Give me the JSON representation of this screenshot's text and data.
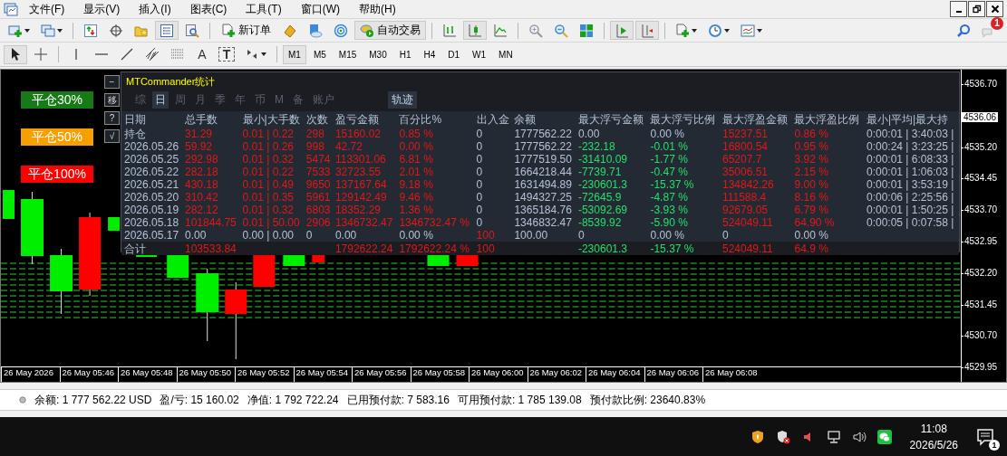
{
  "menu": [
    "文件(F)",
    "显示(V)",
    "插入(I)",
    "图表(C)",
    "工具(T)",
    "窗口(W)",
    "帮助(H)"
  ],
  "toolbar_1": [
    {
      "kind": "icon",
      "pressed": false
    },
    {
      "kind": "icon",
      "pressed": false
    },
    {
      "kind": "separator"
    },
    {
      "kind": "icon",
      "pressed": false
    },
    {
      "kind": "icon",
      "pressed": false
    },
    {
      "kind": "icon",
      "pressed": false
    },
    {
      "kind": "icon",
      "pressed": true
    },
    {
      "kind": "icon",
      "pressed": false
    },
    {
      "kind": "separator"
    },
    {
      "kind": "text",
      "label": "新订单",
      "pressed": false
    },
    {
      "kind": "icon",
      "pressed": false
    },
    {
      "kind": "icon",
      "pressed": false
    },
    {
      "kind": "icon",
      "pressed": false
    },
    {
      "kind": "text",
      "label": "自动交易",
      "pressed": true
    },
    {
      "kind": "separator"
    },
    {
      "kind": "icon",
      "pressed": false
    },
    {
      "kind": "icon",
      "pressed": true
    },
    {
      "kind": "icon",
      "pressed": false
    },
    {
      "kind": "separator"
    },
    {
      "kind": "icon",
      "pressed": false
    },
    {
      "kind": "icon",
      "pressed": false
    },
    {
      "kind": "icon",
      "pressed": false
    },
    {
      "kind": "separator"
    },
    {
      "kind": "icon",
      "pressed": true
    },
    {
      "kind": "icon",
      "pressed": true
    },
    {
      "kind": "separator"
    },
    {
      "kind": "icon",
      "pressed": false
    },
    {
      "kind": "icon",
      "pressed": false
    },
    {
      "kind": "icon",
      "pressed": false
    }
  ],
  "chat_badge": "1",
  "toolbar_2": [
    {
      "kind": "icon",
      "pressed": true
    },
    {
      "kind": "icon",
      "pressed": false
    },
    {
      "kind": "separator"
    },
    {
      "kind": "icon",
      "pressed": false
    },
    {
      "kind": "icon",
      "pressed": false
    },
    {
      "kind": "icon",
      "pressed": false
    },
    {
      "kind": "icon",
      "pressed": false
    },
    {
      "kind": "icon",
      "pressed": false
    },
    {
      "kind": "text",
      "label": "A",
      "pressed": false
    },
    {
      "kind": "text",
      "label": "T",
      "pressed": false
    },
    {
      "kind": "icon",
      "pressed": false
    }
  ],
  "timeframes": [
    {
      "label": "M1",
      "selected": true
    },
    {
      "label": "M5",
      "selected": false
    },
    {
      "label": "M15",
      "selected": false
    },
    {
      "label": "M30",
      "selected": false
    },
    {
      "label": "H1",
      "selected": false
    },
    {
      "label": "H4",
      "selected": false
    },
    {
      "label": "D1",
      "selected": false
    },
    {
      "label": "W1",
      "selected": false
    },
    {
      "label": "MN",
      "selected": false
    }
  ],
  "chart": {
    "close_buttons": [
      {
        "label": "平仓30%",
        "color": "#167a16"
      },
      {
        "label": "平仓50%",
        "color": "#f5a000"
      },
      {
        "label": "平仓100%",
        "color": "#ff0000"
      }
    ],
    "side_buttons": [
      "−",
      "移",
      "?",
      "√"
    ],
    "price_axis": {
      "labels": [
        "4536.70",
        "4535.20",
        "4534.45",
        "4533.70",
        "4532.95",
        "4532.20",
        "4531.45",
        "4530.70",
        "4529.95"
      ],
      "current": "4536.06"
    },
    "time_axis": [
      "26 May 2026",
      "26 May 05:46",
      "26 May 05:48",
      "26 May 05:50",
      "26 May 05:52",
      "26 May 05:54",
      "26 May 05:56",
      "26 May 05:58",
      "26 May 06:00",
      "26 May 06:02",
      "26 May 06:04",
      "26 May 06:06",
      "26 May 06:08"
    ]
  },
  "stats_panel": {
    "title": "MTCommander统计",
    "tabs": [
      {
        "label": "综",
        "selected": false
      },
      {
        "label": "日",
        "selected": true
      },
      {
        "label": "周",
        "selected": false
      },
      {
        "label": "月",
        "selected": false
      },
      {
        "label": "季",
        "selected": false
      },
      {
        "label": "年",
        "selected": false
      },
      {
        "label": "币",
        "selected": false
      },
      {
        "label": "M",
        "selected": false
      },
      {
        "label": "备",
        "selected": false
      },
      {
        "label": "账户",
        "selected": false
      }
    ],
    "trail_button": "轨迹",
    "columns": [
      "日期",
      "总手数",
      "最小|大手数",
      "次数",
      "盈亏金额",
      "百分比%",
      "出入金",
      "余额",
      "最大浮亏金额",
      "最大浮亏比例",
      "最大浮盈金额",
      "最大浮盈比例",
      "最小|平均|最大持"
    ],
    "rows": [
      {
        "cells": [
          {
            "text": "持仓"
          },
          {
            "text": "31.29",
            "color": "#e01818"
          },
          {
            "text": "0.01 | 0.22",
            "color": "#e01818"
          },
          {
            "text": "298",
            "color": "#e01818"
          },
          {
            "text": "15160.02",
            "color": "#e01818"
          },
          {
            "text": "0.85 %",
            "color": "#e01818"
          },
          {
            "text": "0",
            "color": "#b4c2d6"
          },
          {
            "text": "1777562.22",
            "color": "#b4c2d6"
          },
          {
            "text": "0.00",
            "color": "#b4c2d6"
          },
          {
            "text": "0.00 %",
            "color": "#b4c2d6"
          },
          {
            "text": "15237.51",
            "color": "#e01818"
          },
          {
            "text": "0.86 %",
            "color": "#e01818"
          },
          {
            "text": "0:00:01 | 3:40:03 |",
            "color": "#b4c2d6"
          }
        ]
      },
      {
        "cells": [
          {
            "text": "2026.05.26",
            "color": "#b4c2d6"
          },
          {
            "text": "59.92",
            "color": "#e01818"
          },
          {
            "text": "0.01 | 0.26",
            "color": "#e01818"
          },
          {
            "text": "998",
            "color": "#e01818"
          },
          {
            "text": "42.72",
            "color": "#e01818"
          },
          {
            "text": "0.00 %",
            "color": "#e01818"
          },
          {
            "text": "0",
            "color": "#b4c2d6"
          },
          {
            "text": "1777562.22",
            "color": "#b4c2d6"
          },
          {
            "text": "-232.18",
            "color": "#22e06a"
          },
          {
            "text": "-0.01 %",
            "color": "#22e06a"
          },
          {
            "text": "16800.54",
            "color": "#e01818"
          },
          {
            "text": "0.95 %",
            "color": "#e01818"
          },
          {
            "text": "0:00:24 | 3:23:25 |",
            "color": "#b4c2d6"
          }
        ]
      },
      {
        "cells": [
          {
            "text": "2026.05.25",
            "color": "#b4c2d6"
          },
          {
            "text": "292.98",
            "color": "#e01818"
          },
          {
            "text": "0.01 | 0.32",
            "color": "#e01818"
          },
          {
            "text": "5474",
            "color": "#e01818"
          },
          {
            "text": "113301.06",
            "color": "#e01818"
          },
          {
            "text": "6.81 %",
            "color": "#e01818"
          },
          {
            "text": "0",
            "color": "#b4c2d6"
          },
          {
            "text": "1777519.50",
            "color": "#b4c2d6"
          },
          {
            "text": "-31410.09",
            "color": "#22e06a"
          },
          {
            "text": "-1.77 %",
            "color": "#22e06a"
          },
          {
            "text": "65207.7",
            "color": "#e01818"
          },
          {
            "text": "3.92 %",
            "color": "#e01818"
          },
          {
            "text": "0:00:01 | 6:08:33 |",
            "color": "#b4c2d6"
          }
        ]
      },
      {
        "cells": [
          {
            "text": "2026.05.22",
            "color": "#b4c2d6"
          },
          {
            "text": "282.18",
            "color": "#e01818"
          },
          {
            "text": "0.01 | 0.22",
            "color": "#e01818"
          },
          {
            "text": "7533",
            "color": "#e01818"
          },
          {
            "text": "32723.55",
            "color": "#e01818"
          },
          {
            "text": "2.01 %",
            "color": "#e01818"
          },
          {
            "text": "0",
            "color": "#b4c2d6"
          },
          {
            "text": "1664218.44",
            "color": "#b4c2d6"
          },
          {
            "text": "-7739.71",
            "color": "#22e06a"
          },
          {
            "text": "-0.47 %",
            "color": "#22e06a"
          },
          {
            "text": "35006.51",
            "color": "#e01818"
          },
          {
            "text": "2.15 %",
            "color": "#e01818"
          },
          {
            "text": "0:00:01 | 1:06:03 |",
            "color": "#b4c2d6"
          }
        ]
      },
      {
        "cells": [
          {
            "text": "2026.05.21",
            "color": "#b4c2d6"
          },
          {
            "text": "430.18",
            "color": "#e01818"
          },
          {
            "text": "0.01 | 0.49",
            "color": "#e01818"
          },
          {
            "text": "9650",
            "color": "#e01818"
          },
          {
            "text": "137167.64",
            "color": "#e01818"
          },
          {
            "text": "9.18 %",
            "color": "#e01818"
          },
          {
            "text": "0",
            "color": "#b4c2d6"
          },
          {
            "text": "1631494.89",
            "color": "#b4c2d6"
          },
          {
            "text": "-230601.3",
            "color": "#22e06a"
          },
          {
            "text": "-15.37 %",
            "color": "#22e06a"
          },
          {
            "text": "134842.26",
            "color": "#e01818"
          },
          {
            "text": "9.00 %",
            "color": "#e01818"
          },
          {
            "text": "0:00:01 | 3:53:19 |",
            "color": "#b4c2d6"
          }
        ]
      },
      {
        "cells": [
          {
            "text": "2026.05.20",
            "color": "#b4c2d6"
          },
          {
            "text": "310.42",
            "color": "#e01818"
          },
          {
            "text": "0.01 | 0.35",
            "color": "#e01818"
          },
          {
            "text": "5961",
            "color": "#e01818"
          },
          {
            "text": "129142.49",
            "color": "#e01818"
          },
          {
            "text": "9.46 %",
            "color": "#e01818"
          },
          {
            "text": "0",
            "color": "#b4c2d6"
          },
          {
            "text": "1494327.25",
            "color": "#b4c2d6"
          },
          {
            "text": "-72645.9",
            "color": "#22e06a"
          },
          {
            "text": "-4.87 %",
            "color": "#22e06a"
          },
          {
            "text": "111588.4",
            "color": "#e01818"
          },
          {
            "text": "8.16 %",
            "color": "#e01818"
          },
          {
            "text": "0:00:06 | 2:25:56 |",
            "color": "#b4c2d6"
          }
        ]
      },
      {
        "cells": [
          {
            "text": "2026.05.19",
            "color": "#b4c2d6"
          },
          {
            "text": "282.12",
            "color": "#e01818"
          },
          {
            "text": "0.01 | 0.32",
            "color": "#e01818"
          },
          {
            "text": "6803",
            "color": "#e01818"
          },
          {
            "text": "18352.29",
            "color": "#e01818"
          },
          {
            "text": "1.36 %",
            "color": "#e01818"
          },
          {
            "text": "0",
            "color": "#b4c2d6"
          },
          {
            "text": "1365184.76",
            "color": "#b4c2d6"
          },
          {
            "text": "-53092.69",
            "color": "#22e06a"
          },
          {
            "text": "-3.93 %",
            "color": "#22e06a"
          },
          {
            "text": "92679.05",
            "color": "#e01818"
          },
          {
            "text": "6.79 %",
            "color": "#e01818"
          },
          {
            "text": "0:00:01 | 1:50:25 |",
            "color": "#b4c2d6"
          }
        ]
      },
      {
        "cells": [
          {
            "text": "2026.05.18",
            "color": "#b4c2d6"
          },
          {
            "text": "101844.75",
            "color": "#e01818"
          },
          {
            "text": "0.01 | 50.00",
            "color": "#e01818"
          },
          {
            "text": "2906",
            "color": "#e01818"
          },
          {
            "text": "1346732.47",
            "color": "#e01818"
          },
          {
            "text": "1346732.47 %",
            "color": "#e01818"
          },
          {
            "text": "0",
            "color": "#b4c2d6"
          },
          {
            "text": "1346832.47",
            "color": "#b4c2d6"
          },
          {
            "text": "-8539.92",
            "color": "#22e06a"
          },
          {
            "text": "-5.90 %",
            "color": "#22e06a"
          },
          {
            "text": "524049.11",
            "color": "#e01818"
          },
          {
            "text": "64.90 %",
            "color": "#e01818"
          },
          {
            "text": "0:00:05 | 0:07:58 |",
            "color": "#b4c2d6"
          }
        ]
      },
      {
        "cells": [
          {
            "text": "2026.05.17",
            "color": "#b4c2d6"
          },
          {
            "text": "0.00",
            "color": "#b4c2d6"
          },
          {
            "text": "0.00 | 0.00",
            "color": "#b4c2d6"
          },
          {
            "text": "0"
          },
          {
            "text": "0.00",
            "color": "#b4c2d6"
          },
          {
            "text": "0.00 %",
            "color": "#b4c2d6"
          },
          {
            "text": "100",
            "color": "#e01818"
          },
          {
            "text": "100.00",
            "color": "#b4c2d6"
          },
          {
            "text": "0",
            "color": "#b4c2d6"
          },
          {
            "text": "0.00 %",
            "color": "#b4c2d6"
          },
          {
            "text": "0",
            "color": "#b4c2d6"
          },
          {
            "text": "0.00 %",
            "color": "#b4c2d6"
          }
        ]
      }
    ],
    "total": {
      "c0": {
        "text": "合计"
      },
      "c1": {
        "text": "103533.84",
        "color": "#e01818"
      },
      "c4": {
        "text": "1792622.24",
        "color": "#e01818"
      },
      "c5": {
        "text": "1792622.24 %",
        "color": "#e01818"
      },
      "c6": {
        "text": "100",
        "color": "#e01818"
      },
      "c8": {
        "text": "-230601.3",
        "color": "#22e06a"
      },
      "c9": {
        "text": "-15.37 %",
        "color": "#22e06a"
      },
      "c10": {
        "text": "524049.11",
        "color": "#e01818"
      },
      "c11": {
        "text": "64.9 %",
        "color": "#e01818"
      }
    }
  },
  "status_bar": [
    {
      "label": "余额:",
      "value": "1 777 562.22 USD"
    },
    {
      "label": "盈/亏:",
      "value": "15 160.02"
    },
    {
      "label": "净值:",
      "value": "1 792 722.24"
    },
    {
      "label": "已用预付款:",
      "value": "7 583.16"
    },
    {
      "label": "可用预付款:",
      "value": "1 785 139.08"
    },
    {
      "label": "预付款比例:",
      "value": "23640.83%"
    }
  ],
  "taskbar": {
    "time": "11:08",
    "date": "2026/5/26",
    "notifications": "1"
  }
}
